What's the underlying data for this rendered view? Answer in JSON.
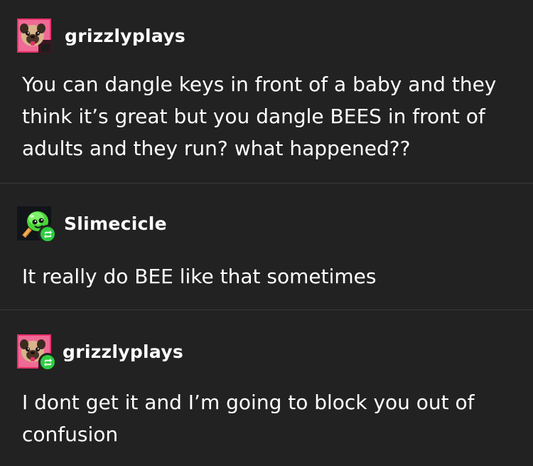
{
  "posts": [
    {
      "username": "grizzlyplays",
      "avatar": "pug-avatar",
      "reblogged": false,
      "text": "You can dangle keys in front of a baby and they think it’s great but you dangle BEES in front of adults and they run? what happened??"
    },
    {
      "username": "Slimecicle",
      "avatar": "slime-popsicle-avatar",
      "reblogged": true,
      "text": "It really do BEE like that sometimes"
    },
    {
      "username": "grizzlyplays",
      "avatar": "pug-avatar",
      "reblogged": true,
      "text": "I dont get it and I’m going to block you out of confusion"
    }
  ],
  "colors": {
    "background": "#222222",
    "divider": "#3a3a3a",
    "text": "#ffffff",
    "reblog_badge": "#2ecc40",
    "avatar_pink": "#e8306a",
    "slime_green": "#4cd43a"
  },
  "icons": {
    "reblog": "reblog-icon"
  }
}
